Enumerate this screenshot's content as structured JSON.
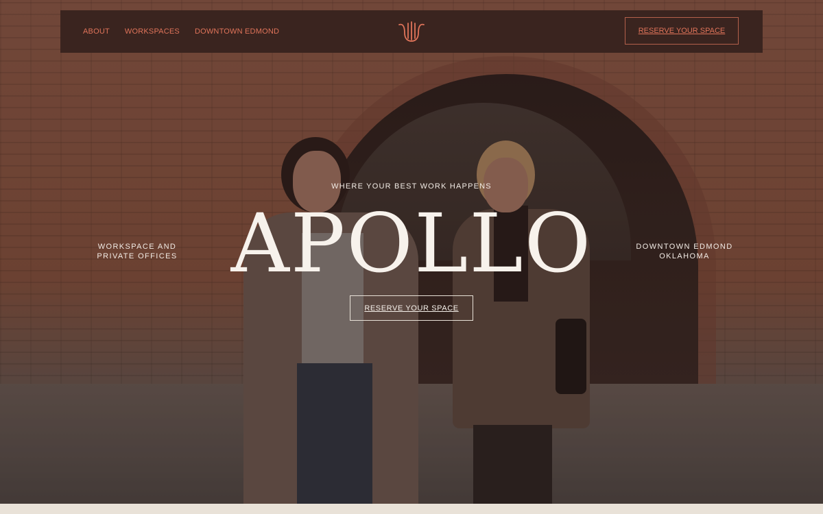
{
  "nav": {
    "links": [
      "ABOUT",
      "WORKSPACES",
      "DOWNTOWN EDMOND"
    ],
    "cta_label": "RESERVE YOUR SPACE",
    "logo_icon": "apollo-lyre-logo-icon",
    "background_color": "#3a241f",
    "accent_color": "#e0745a"
  },
  "hero": {
    "tagline": "WHERE YOUR BEST WORK HAPPENS",
    "brand_name": "APOLLO",
    "left_caption": [
      "WORKSPACE AND",
      "PRIVATE OFFICES"
    ],
    "right_caption": [
      "DOWNTOWN EDMOND",
      "OKLAHOMA"
    ],
    "cta_label": "RESERVE YOUR SPACE"
  }
}
